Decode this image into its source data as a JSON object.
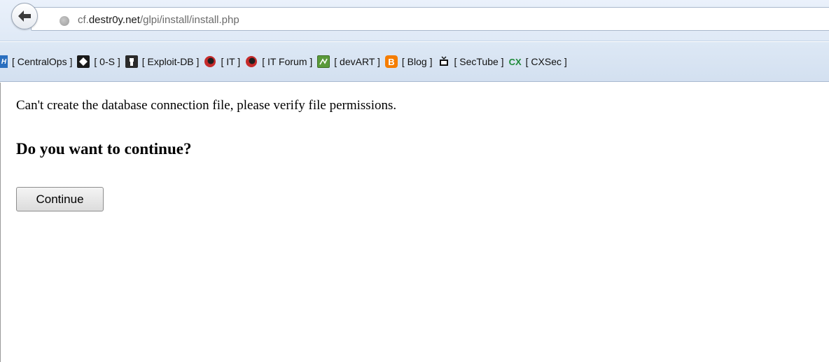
{
  "browser": {
    "url_prefix": "cf.",
    "url_host": "destr0y.net",
    "url_path": "/glpi/install/install.php"
  },
  "bookmarks": [
    {
      "icon_text": "H",
      "label": "[ CentralOps ]"
    },
    {
      "icon_text": "",
      "label": "[ 0-S ]"
    },
    {
      "icon_text": "",
      "label": "[ Exploit-DB ]"
    },
    {
      "icon_text": "",
      "label": "[ IT ]"
    },
    {
      "icon_text": "",
      "label": "[ IT Forum ]"
    },
    {
      "icon_text": "",
      "label": "[ devART ]"
    },
    {
      "icon_text": "B",
      "label": "[ Blog ]"
    },
    {
      "icon_text": "",
      "label": "[ SecTube ]"
    },
    {
      "icon_text": "CX",
      "label": "[ CXSec ]"
    }
  ],
  "page": {
    "message": "Can't create the database connection file, please verify file permissions.",
    "question": "Do you want to continue?",
    "continue_label": "Continue"
  }
}
